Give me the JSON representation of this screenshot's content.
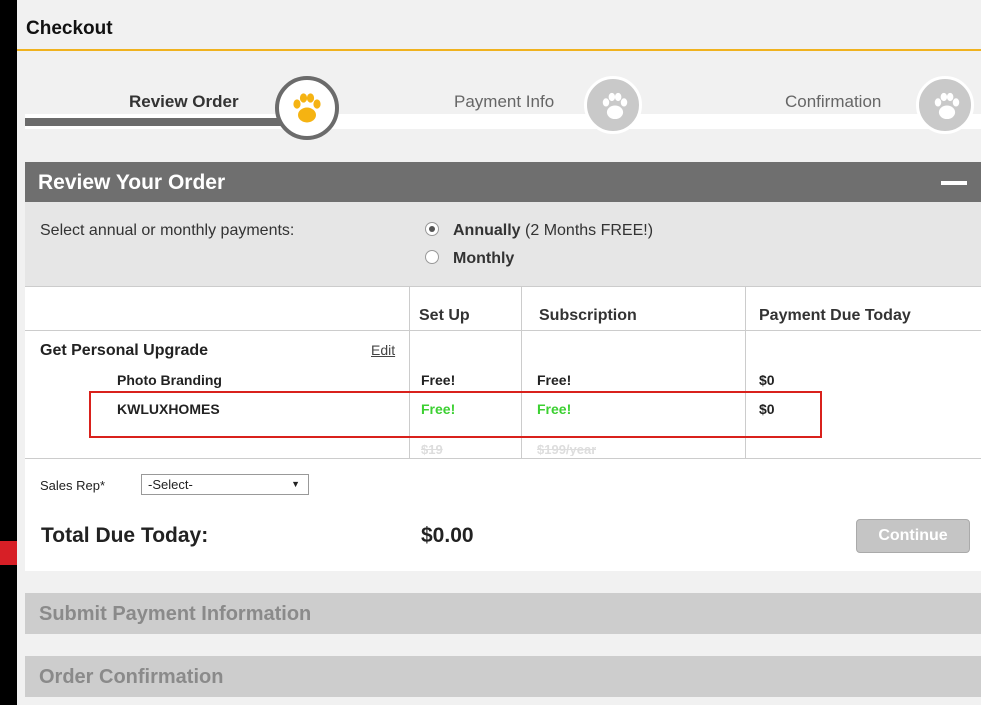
{
  "checkout": {
    "title": "Checkout"
  },
  "steps": [
    {
      "label": "Review Order",
      "state": "active"
    },
    {
      "label": "Payment Info",
      "state": "pending"
    },
    {
      "label": "Confirmation",
      "state": "pending"
    }
  ],
  "review": {
    "title": "Review Your Order",
    "payment_prompt": "Select annual or monthly payments:",
    "options": [
      {
        "label": "Annually",
        "note": "(2 Months FREE!)",
        "selected": true
      },
      {
        "label": "Monthly",
        "note": "",
        "selected": false
      }
    ]
  },
  "table": {
    "headers": [
      "Set Up",
      "Subscription",
      "Payment Due Today"
    ],
    "product": "Get Personal Upgrade",
    "edit_label": "Edit",
    "rows": [
      {
        "name": "Photo Branding",
        "setup": "Free!",
        "subscription": "Free!",
        "due": "$0"
      },
      {
        "name": "KWLUXHOMES",
        "setup": "Free!",
        "subscription": "Free!",
        "due": "$0",
        "setup_original": "$19",
        "subscription_original": "$199/year"
      }
    ]
  },
  "sales_rep": {
    "label": "Sales Rep*",
    "value": "-Select-"
  },
  "total": {
    "label": "Total Due Today:",
    "value": "$0.00"
  },
  "continue_label": "Continue",
  "sections": {
    "submit_payment": "Submit Payment Information",
    "order_confirmation": "Order Confirmation"
  },
  "colors": {
    "accent": "#f0b21e",
    "highlight_border": "#d9211c",
    "free_green": "#3cd032",
    "panel_header": "#6f6f6f"
  },
  "icons": {
    "step": "paw-icon"
  }
}
